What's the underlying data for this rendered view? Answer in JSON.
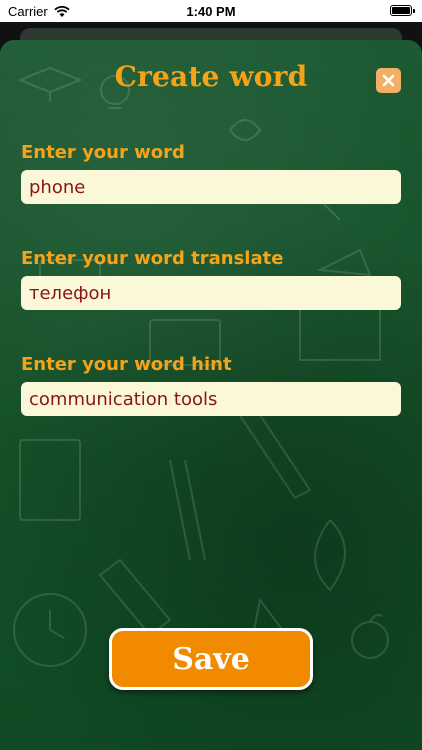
{
  "status_bar": {
    "carrier": "Carrier",
    "time": "1:40 PM"
  },
  "header": {
    "title": "Create word",
    "close_icon": "close-icon"
  },
  "form": {
    "word": {
      "label": "Enter your word",
      "value": "phone"
    },
    "translate": {
      "label": "Enter your word translate",
      "value": "телефон"
    },
    "hint": {
      "label": "Enter your word hint",
      "value": "communication tools"
    }
  },
  "actions": {
    "save_label": "Save"
  },
  "colors": {
    "accent": "#f5a31a",
    "board": "#165229",
    "field_bg": "#fbf8d9",
    "field_text": "#8a1414",
    "button": "#f28a00"
  }
}
